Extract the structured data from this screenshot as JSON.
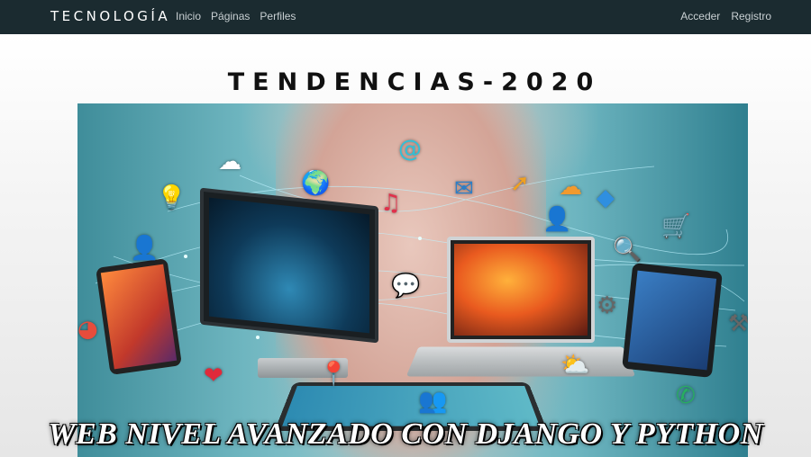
{
  "navbar": {
    "brand": "TECNOLOGÍA",
    "left_links": [
      {
        "label": "Inicio"
      },
      {
        "label": "Páginas"
      },
      {
        "label": "Perfiles"
      }
    ],
    "right_links": [
      {
        "label": "Acceder"
      },
      {
        "label": "Registro"
      }
    ],
    "background": "#1b2b30"
  },
  "main": {
    "title": "TENDENCIAS-2020",
    "banner_caption": "WEB NIVEL AVANZADO CON DJANGO Y PYTHON"
  },
  "hero_icons": [
    {
      "name": "cloud-download-icon",
      "glyph": "☁",
      "color": "#ffffff"
    },
    {
      "name": "at-sign-icon",
      "glyph": "@",
      "color": "#2fc0d8"
    },
    {
      "name": "globe-icon",
      "glyph": "🌍",
      "color": "#2e8b57"
    },
    {
      "name": "lightbulb-icon",
      "glyph": "💡",
      "color": "#f5c400"
    },
    {
      "name": "music-note-icon",
      "glyph": "♫",
      "color": "#e0314b"
    },
    {
      "name": "envelope-icon",
      "glyph": "✉",
      "color": "#2b7ec7"
    },
    {
      "name": "arrow-icon",
      "glyph": "➚",
      "color": "#f0a020"
    },
    {
      "name": "cloud-icon",
      "glyph": "☁",
      "color": "#f29a2e"
    },
    {
      "name": "diamond-icon",
      "glyph": "◆",
      "color": "#2f8fe0"
    },
    {
      "name": "user-icon",
      "glyph": "👤",
      "color": "#d43c6a"
    },
    {
      "name": "shopping-cart-icon",
      "glyph": "🛒",
      "color": "#c0392b"
    },
    {
      "name": "magnifier-icon",
      "glyph": "🔍",
      "color": "#2f6fe0"
    },
    {
      "name": "chat-bubble-icon",
      "glyph": "💬",
      "color": "#4caf50"
    },
    {
      "name": "gear-icon",
      "glyph": "⚙",
      "color": "#666666"
    },
    {
      "name": "tools-icon",
      "glyph": "⚒",
      "color": "#666666"
    },
    {
      "name": "user-left-icon",
      "glyph": "👤",
      "color": "#2f6fe0"
    },
    {
      "name": "pie-chart-icon",
      "glyph": "◕",
      "color": "#e74c3c"
    },
    {
      "name": "heart-icon",
      "glyph": "❤",
      "color": "#e02a3a"
    },
    {
      "name": "location-pin-icon",
      "glyph": "📍",
      "color": "#e02a3a"
    },
    {
      "name": "group-icon",
      "glyph": "👥",
      "color": "#e67e22"
    },
    {
      "name": "weather-icon",
      "glyph": "⛅",
      "color": "#f5a623"
    },
    {
      "name": "phone-icon",
      "glyph": "✆",
      "color": "#27ae60"
    }
  ]
}
